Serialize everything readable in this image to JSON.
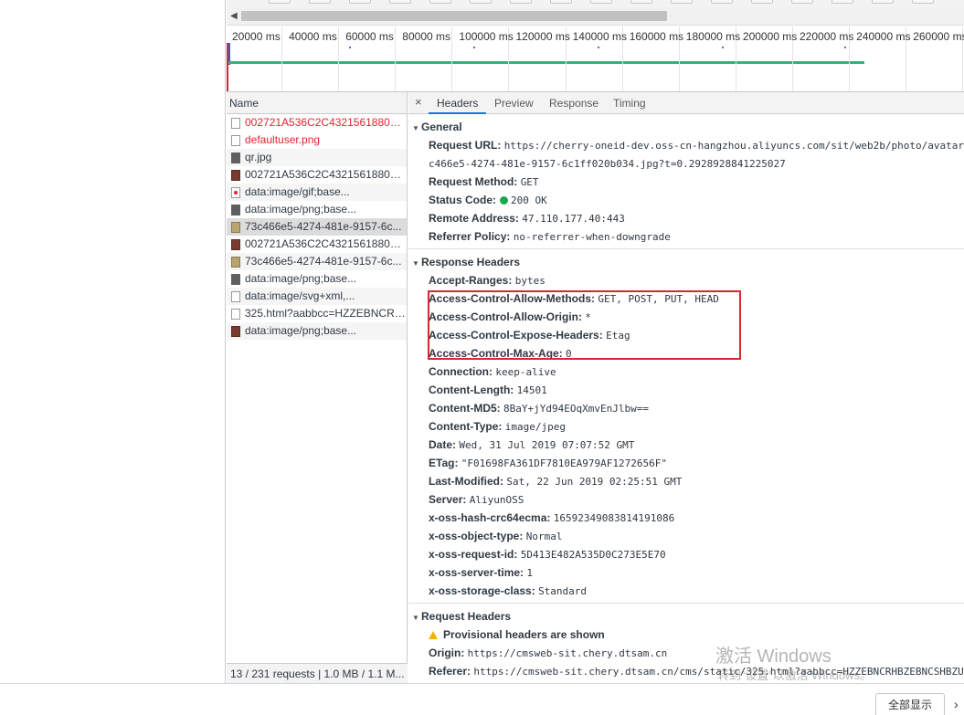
{
  "timeline": {
    "ticks": [
      "20000 ms",
      "40000 ms",
      "60000 ms",
      "80000 ms",
      "100000 ms",
      "120000 ms",
      "140000 ms",
      "160000 ms",
      "180000 ms",
      "200000 ms",
      "220000 ms",
      "240000 ms",
      "260000 ms"
    ]
  },
  "requests": {
    "header": "Name",
    "items": [
      {
        "name": "002721A536C2C432156188015...",
        "icon": "document-icon",
        "error": true
      },
      {
        "name": "defaultuser.png",
        "icon": "document-icon",
        "error": true
      },
      {
        "name": "qr.jpg",
        "icon": "image-icon",
        "error": false
      },
      {
        "name": "002721A536C2C432156188015...",
        "icon": "image-icon",
        "error": false
      },
      {
        "name": "data:image/gif;base...",
        "icon": "gif-icon",
        "error": false
      },
      {
        "name": "data:image/png;base...",
        "icon": "image-icon",
        "error": false
      },
      {
        "name": "73c466e5-4274-481e-9157-6c...",
        "icon": "image-icon",
        "error": false
      },
      {
        "name": "002721A536C2C432156188015...",
        "icon": "image-icon",
        "error": false
      },
      {
        "name": "73c466e5-4274-481e-9157-6c...",
        "icon": "image-icon",
        "error": false
      },
      {
        "name": "data:image/png;base...",
        "icon": "image-icon",
        "error": false
      },
      {
        "name": "data:image/svg+xml,...",
        "icon": "document-icon",
        "error": false
      },
      {
        "name": "325.html?aabbcc=HZZEBNCRH...",
        "icon": "document-icon",
        "error": false
      },
      {
        "name": "data:image/png;base...",
        "icon": "image-icon",
        "error": false
      }
    ],
    "footer": "13 / 231 requests  |  1.0 MB / 1.1 M..."
  },
  "tabs": {
    "close": "×",
    "items": [
      "Headers",
      "Preview",
      "Response",
      "Timing"
    ],
    "active": "Headers"
  },
  "general": {
    "title": "General",
    "request_url_label": "Request URL:",
    "request_url_value": "https://cherry-oneid-dev.oss-cn-hangzhou.aliyuncs.com/sit/web2b/photo/avatar/",
    "request_url_cont": "c466e5-4274-481e-9157-6c1ff020b034.jpg?t=0.2928928841225027",
    "request_method_label": "Request Method:",
    "request_method_value": "GET",
    "status_code_label": "Status Code:",
    "status_code_value": "200 OK",
    "remote_address_label": "Remote Address:",
    "remote_address_value": "47.110.177.40:443",
    "referrer_policy_label": "Referrer Policy:",
    "referrer_policy_value": "no-referrer-when-downgrade"
  },
  "response_headers": {
    "title": "Response Headers",
    "items": [
      {
        "k": "Accept-Ranges:",
        "v": "bytes"
      },
      {
        "k": "Access-Control-Allow-Methods:",
        "v": "GET, POST, PUT, HEAD"
      },
      {
        "k": "Access-Control-Allow-Origin:",
        "v": "*"
      },
      {
        "k": "Access-Control-Expose-Headers:",
        "v": "Etag"
      },
      {
        "k": "Access-Control-Max-Age:",
        "v": "0"
      },
      {
        "k": "Connection:",
        "v": "keep-alive"
      },
      {
        "k": "Content-Length:",
        "v": "14501"
      },
      {
        "k": "Content-MD5:",
        "v": "8BaY+jYd94EOqXmvEnJlbw=="
      },
      {
        "k": "Content-Type:",
        "v": "image/jpeg"
      },
      {
        "k": "Date:",
        "v": "Wed, 31 Jul 2019 07:07:52 GMT"
      },
      {
        "k": "ETag:",
        "v": "\"F01698FA361DF7810EA979AF1272656F\""
      },
      {
        "k": "Last-Modified:",
        "v": "Sat, 22 Jun 2019 02:25:51 GMT"
      },
      {
        "k": "Server:",
        "v": "AliyunOSS"
      },
      {
        "k": "x-oss-hash-crc64ecma:",
        "v": "16592349083814191086"
      },
      {
        "k": "x-oss-object-type:",
        "v": "Normal"
      },
      {
        "k": "x-oss-request-id:",
        "v": "5D413E482A535D0C273E5E70"
      },
      {
        "k": "x-oss-server-time:",
        "v": "1"
      },
      {
        "k": "x-oss-storage-class:",
        "v": "Standard"
      }
    ]
  },
  "request_headers": {
    "title": "Request Headers",
    "warning": "Provisional headers are shown",
    "origin_label": "Origin:",
    "origin_value": "https://cmsweb-sit.chery.dtsam.cn",
    "referer_label": "Referer:",
    "referer_value": "https://cmsweb-sit.chery.dtsam.cn/cms/static/325.html?aabbcc=HZZEBNCRHBZEBNCSHBZU"
  },
  "watermark": {
    "title": "激活 Windows",
    "subtitle": "转到“设置”以激活 Windows。"
  },
  "bottom": {
    "show_all": "全部显示",
    "chevron": "›"
  },
  "colors": {
    "accent": "#1a73e8",
    "error": "#e0242e",
    "timeline_bar": "#35b07a",
    "status_ok": "#1aa84c"
  }
}
